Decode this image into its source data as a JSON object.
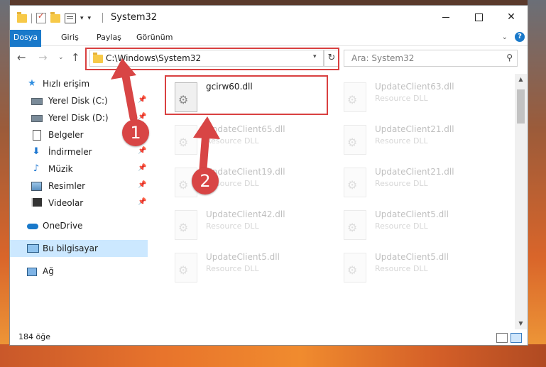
{
  "window": {
    "title": "System32"
  },
  "ribbon": {
    "tabs": [
      "Dosya",
      "Giriş",
      "Paylaş",
      "Görünüm"
    ]
  },
  "navigation": {
    "address_path": "C:\\Windows\\System32",
    "search_placeholder": "Ara: System32"
  },
  "sidebar": {
    "items": [
      {
        "label": "Hızlı erişim",
        "icon": "star-icon",
        "pinned": false,
        "selected": false
      },
      {
        "label": "Yerel Disk (C:)",
        "icon": "drive-icon",
        "pinned": true,
        "selected": false
      },
      {
        "label": "Yerel Disk (D:)",
        "icon": "drive-icon",
        "pinned": true,
        "selected": false
      },
      {
        "label": "Belgeler",
        "icon": "documents-icon",
        "pinned": true,
        "selected": false
      },
      {
        "label": "İndirmeler",
        "icon": "download-icon",
        "pinned": true,
        "selected": false
      },
      {
        "label": "Müzik",
        "icon": "music-icon",
        "pinned": true,
        "selected": false
      },
      {
        "label": "Resimler",
        "icon": "pictures-icon",
        "pinned": true,
        "selected": false
      },
      {
        "label": "Videolar",
        "icon": "videos-icon",
        "pinned": true,
        "selected": false
      },
      {
        "label": "OneDrive",
        "icon": "cloud-icon",
        "pinned": false,
        "selected": false
      },
      {
        "label": "Bu bilgisayar",
        "icon": "computer-icon",
        "pinned": false,
        "selected": true
      },
      {
        "label": "Ağ",
        "icon": "network-icon",
        "pinned": false,
        "selected": false
      }
    ]
  },
  "files": [
    {
      "name": "gcirw60.dll",
      "type": "",
      "highlighted": true
    },
    {
      "name": "UpdateClient63.dll",
      "type": "Resource DLL",
      "highlighted": false
    },
    {
      "name": "UpdateClient65.dll",
      "type": "Resource DLL",
      "highlighted": false
    },
    {
      "name": "UpdateClient21.dll",
      "type": "Resource DLL",
      "highlighted": false
    },
    {
      "name": "UpdateClient19.dll",
      "type": "Resource DLL",
      "highlighted": false
    },
    {
      "name": "UpdateClient21.dll",
      "type": "Resource DLL",
      "highlighted": false
    },
    {
      "name": "UpdateClient42.dll",
      "type": "Resource DLL",
      "highlighted": false
    },
    {
      "name": "UpdateClient5.dll",
      "type": "Resource DLL",
      "highlighted": false
    },
    {
      "name": "UpdateClient5.dll",
      "type": "Resource DLL",
      "highlighted": false
    },
    {
      "name": "UpdateClient5.dll",
      "type": "Resource DLL",
      "highlighted": false
    }
  ],
  "status": {
    "item_count": "184 öğe"
  },
  "annotations": {
    "step1": "1",
    "step2": "2",
    "color": "#d84545"
  }
}
